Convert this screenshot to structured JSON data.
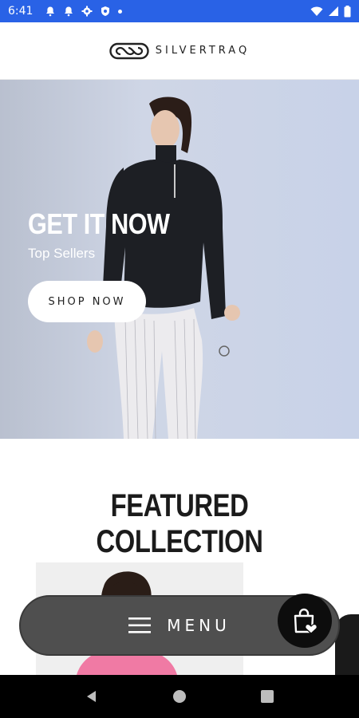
{
  "status_bar": {
    "time": "6:41",
    "left_icons": [
      "notification-bell-icon",
      "notification-bell-icon",
      "settings-gear-icon",
      "shield-icon",
      "dot-icon"
    ],
    "right_icons": [
      "wifi-icon",
      "cellular-signal-icon",
      "battery-icon"
    ]
  },
  "header": {
    "brand": "SILVERTRAQ",
    "logo_icon": "infinity-logo-icon"
  },
  "hero": {
    "title": "GET IT NOW",
    "subtitle": "Top Sellers",
    "button_label": "SHOP NOW"
  },
  "featured": {
    "title": "FEATURED COLLECTION"
  },
  "menu_bar": {
    "label": "MENU",
    "menu_icon": "hamburger-icon",
    "cart_icon": "shopping-bag-heart-icon"
  },
  "nav_bar": {
    "buttons": [
      "back-icon",
      "home-icon",
      "recents-icon"
    ]
  },
  "colors": {
    "status_bar": "#2962e6",
    "menu_bar": "#4f4f4f",
    "cart_button": "#0d0d0d"
  }
}
